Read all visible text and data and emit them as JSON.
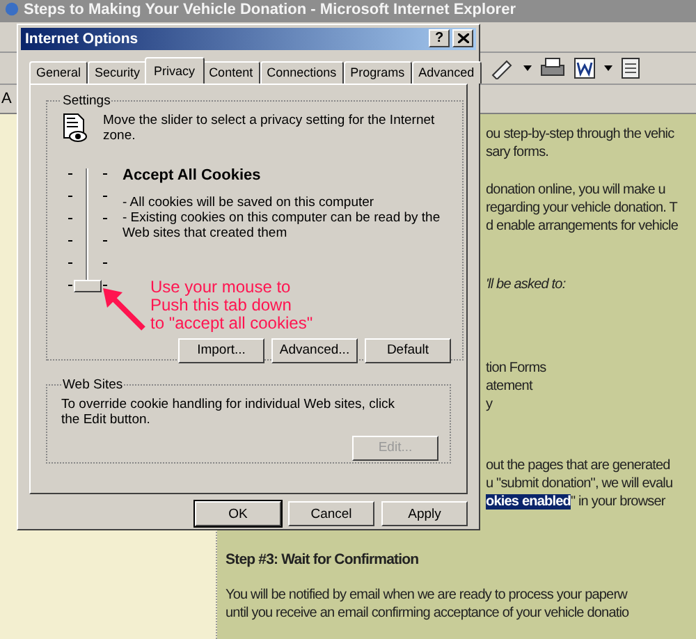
{
  "browser": {
    "title": "Steps to Making Your Vehicle Donation - Microsoft Internet Explorer",
    "address_label": "A",
    "content": {
      "paragraphs": [
        {
          "kind": "plain",
          "lines": [
            "ou step-by-step through the vehic",
            "sary forms."
          ]
        },
        {
          "kind": "plain",
          "lines": [
            "donation online, you will make u",
            "regarding your vehicle donation. T",
            "d enable arrangements for vehicle"
          ]
        },
        {
          "kind": "italic",
          "lines": [
            "'ll be asked to:"
          ]
        },
        {
          "kind": "list",
          "lines": [
            "tion Forms",
            "atement",
            "y"
          ]
        },
        {
          "kind": "plain",
          "lines": [
            "out the pages that are generated",
            "u \"submit donation\", we will evalu"
          ]
        }
      ],
      "highlight_line": {
        "selected_text": "okies enabled",
        "rest": "\" in your browser"
      },
      "step_heading": "Step #3: Wait for Confirmation",
      "step_lines": [
        "You will be notified by email when we are ready to process your paperw",
        "until you receive an email confirming acceptance of your vehicle donatio"
      ]
    }
  },
  "dialog": {
    "title": "Internet Options",
    "help_button": "?",
    "tabs": [
      {
        "label": "General",
        "selected": false
      },
      {
        "label": "Security",
        "selected": false
      },
      {
        "label": "Privacy",
        "selected": true
      },
      {
        "label": "Content",
        "selected": false
      },
      {
        "label": "Connections",
        "selected": false
      },
      {
        "label": "Programs",
        "selected": false
      },
      {
        "label": "Advanced",
        "selected": false
      }
    ],
    "settings": {
      "legend": "Settings",
      "intro": "Move the slider to select a privacy setting for the Internet zone.",
      "slider": {
        "level": 0
      },
      "level_title": "Accept All Cookies",
      "bullets": [
        "- All cookies will be saved on this computer",
        "- Existing cookies on this computer can be read by the Web sites that created them"
      ],
      "buttons": [
        {
          "label": "Import...",
          "disabled": false
        },
        {
          "label": "Advanced...",
          "disabled": false
        },
        {
          "label": "Default",
          "disabled": false
        }
      ]
    },
    "web_sites": {
      "legend": "Web Sites",
      "text": "To override cookie handling for individual Web sites, click the Edit button.",
      "buttons": [
        {
          "label": "Edit...",
          "disabled": true
        }
      ]
    },
    "footer_buttons": [
      {
        "label": "OK",
        "default": true
      },
      {
        "label": "Cancel",
        "default": false
      },
      {
        "label": "Apply",
        "default": false
      }
    ]
  },
  "annotation": {
    "lines": [
      "Use your mouse to",
      "Push this tab down",
      "to \"accept all cookies\""
    ]
  }
}
